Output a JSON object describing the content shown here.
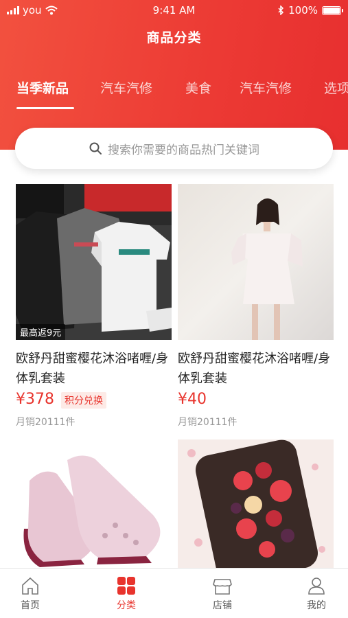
{
  "status_bar": {
    "carrier": "you",
    "time": "9:41 AM",
    "battery": "100%"
  },
  "header": {
    "title": "商品分类"
  },
  "tabs": [
    {
      "label": "当季新品",
      "active": true
    },
    {
      "label": "汽车汽修",
      "active": false
    },
    {
      "label": "美食",
      "active": false
    },
    {
      "label": "汽车汽修",
      "active": false
    },
    {
      "label": "选项",
      "active": false
    }
  ],
  "search": {
    "placeholder": "搜索你需要的商品热门关键词"
  },
  "products": [
    {
      "image": "tshirts",
      "badge": "最高返9元",
      "name": "欧舒丹甜蜜樱花沐浴啫喱/身体乳套装",
      "price": "¥378",
      "points_tag": "积分兑换",
      "sales": "月销20111件"
    },
    {
      "image": "dress",
      "name": "欧舒丹甜蜜樱花沐浴啫喱/身体乳套装",
      "price": "¥40",
      "sales": "月销20111件"
    },
    {
      "image": "sneakers"
    },
    {
      "image": "phone-case"
    }
  ],
  "tabbar": {
    "items": [
      {
        "label": "首页",
        "icon": "home-icon",
        "active": false
      },
      {
        "label": "分类",
        "icon": "category-icon",
        "active": true
      },
      {
        "label": "店铺",
        "icon": "store-icon",
        "active": false
      },
      {
        "label": "我的",
        "icon": "profile-icon",
        "active": false
      }
    ]
  },
  "colors": {
    "brand": "#e8342d",
    "header_start": "#f2513f",
    "header_end": "#e72f2f"
  }
}
